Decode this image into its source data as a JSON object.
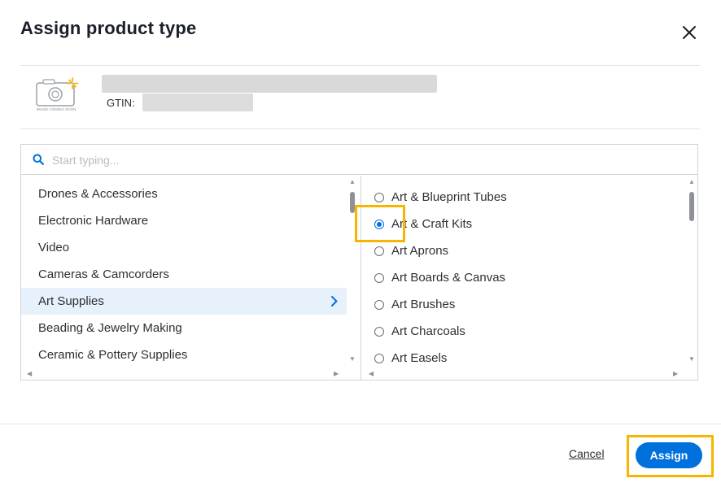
{
  "dialog": {
    "title": "Assign product type",
    "close_icon": "close-icon"
  },
  "product": {
    "image_caption": "IMAGE COMING SOON",
    "gtin_label": "GTIN:"
  },
  "search": {
    "placeholder": "Start typing...",
    "icon": "search-icon"
  },
  "categories": [
    {
      "label": "Drones & Accessories",
      "selected": false
    },
    {
      "label": "Electronic Hardware",
      "selected": false
    },
    {
      "label": "Video",
      "selected": false
    },
    {
      "label": "Cameras & Camcorders",
      "selected": false
    },
    {
      "label": "Art Supplies",
      "selected": true
    },
    {
      "label": "Beading & Jewelry Making",
      "selected": false
    },
    {
      "label": "Ceramic & Pottery Supplies",
      "selected": false
    }
  ],
  "product_types": [
    {
      "label": "Art & Blueprint Tubes",
      "checked": false
    },
    {
      "label": "Art & Craft Kits",
      "checked": true
    },
    {
      "label": "Art Aprons",
      "checked": false
    },
    {
      "label": "Art Boards & Canvas",
      "checked": false
    },
    {
      "label": "Art Brushes",
      "checked": false
    },
    {
      "label": "Art Charcoals",
      "checked": false
    },
    {
      "label": "Art Easels",
      "checked": false
    }
  ],
  "footer": {
    "cancel_label": "Cancel",
    "assign_label": "Assign"
  },
  "colors": {
    "accent": "#0071dc",
    "selected_row": "#e6f1fb",
    "highlight": "#f7b500"
  }
}
